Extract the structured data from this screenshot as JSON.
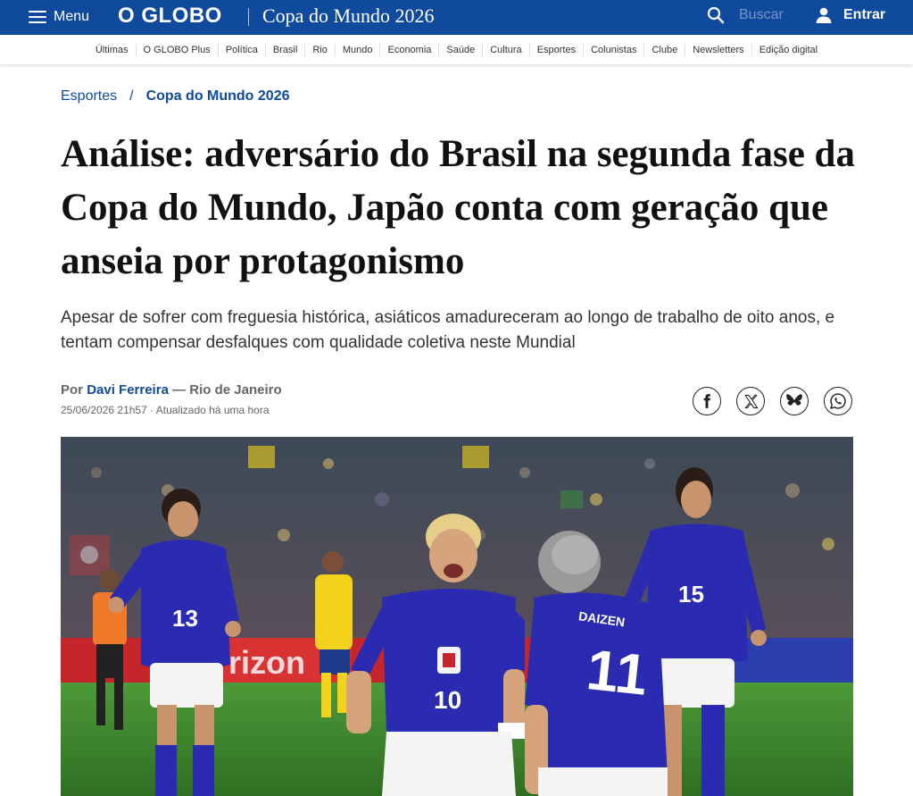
{
  "header": {
    "menu_label": "Menu",
    "logo": "O GLOBO",
    "section_title": "Copa do Mundo 2026",
    "search_placeholder": "Buscar",
    "login_label": "Entrar"
  },
  "subnav": [
    "Últimas",
    "O GLOBO Plus",
    "Política",
    "Brasil",
    "Rio",
    "Mundo",
    "Economia",
    "Saúde",
    "Cultura",
    "Esportes",
    "Colunistas",
    "Clube",
    "Newsletters",
    "Edição digital"
  ],
  "breadcrumb": {
    "parent": "Esportes",
    "separator": "/",
    "current": "Copa do Mundo 2026"
  },
  "article": {
    "title": "Análise: adversário do Brasil na segunda fase da Copa do Mundo, Japão conta com geração que anseia por protagonismo",
    "subtitle": "Apesar de sofrer com freguesia histórica, asiáticos amadureceram ao longo de trabalho de oito anos, e tentam compensar desfalques com qualidade coletiva neste Mundial",
    "byline_prefix": "Por",
    "author": "Davi Ferreira",
    "location": "— Rio de Janeiro",
    "date": "25/06/2026 21h57 · Atualizado há uma hora"
  },
  "share": [
    "facebook-icon",
    "x-icon",
    "bluesky-icon",
    "whatsapp-icon"
  ],
  "photo": {
    "jersey_numbers": [
      "13",
      "10",
      "11",
      "15"
    ],
    "jersey_name": "DAIZEN",
    "board_text": "rizon",
    "colors": {
      "japan_blue": "#2a2bb0",
      "brazil_yellow": "#f2d21b",
      "pitch": "#3f8a2e",
      "brand_blue": "#0f4a9c"
    }
  }
}
